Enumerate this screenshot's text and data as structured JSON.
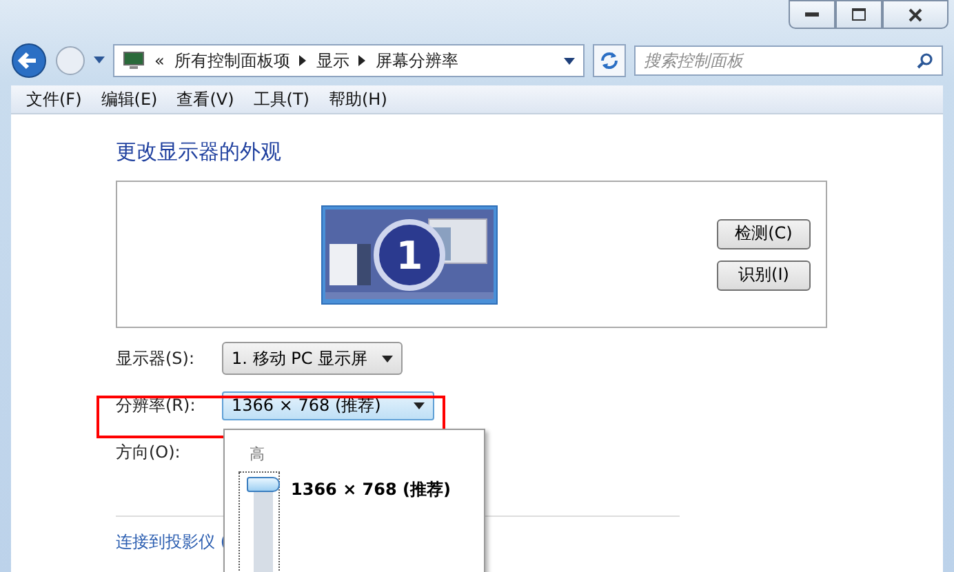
{
  "address_bar": {
    "overflow_mark": "«",
    "breadcrumb": [
      "所有控制面板项",
      "显示",
      "屏幕分辨率"
    ]
  },
  "search": {
    "placeholder": "搜索控制面板"
  },
  "menu": [
    "文件(F)",
    "编辑(E)",
    "查看(V)",
    "工具(T)",
    "帮助(H)"
  ],
  "heading": "更改显示器的外观",
  "preview": {
    "monitor_number": "1",
    "buttons": [
      "检测(C)",
      "识别(I)"
    ]
  },
  "fields": [
    {
      "label": "显示器(S):",
      "value": "1. 移动 PC 显示屏",
      "expanded": false
    },
    {
      "label": "分辨率(R):",
      "value": "1366 × 768 (推荐)",
      "expanded": true
    },
    {
      "label": "方向(O):"
    }
  ],
  "resolution_popup": {
    "top_label": "高",
    "slider": {
      "level": 1
    },
    "current": "1366 × 768 (推荐)"
  },
  "link": "连接到投影仪 ("
}
